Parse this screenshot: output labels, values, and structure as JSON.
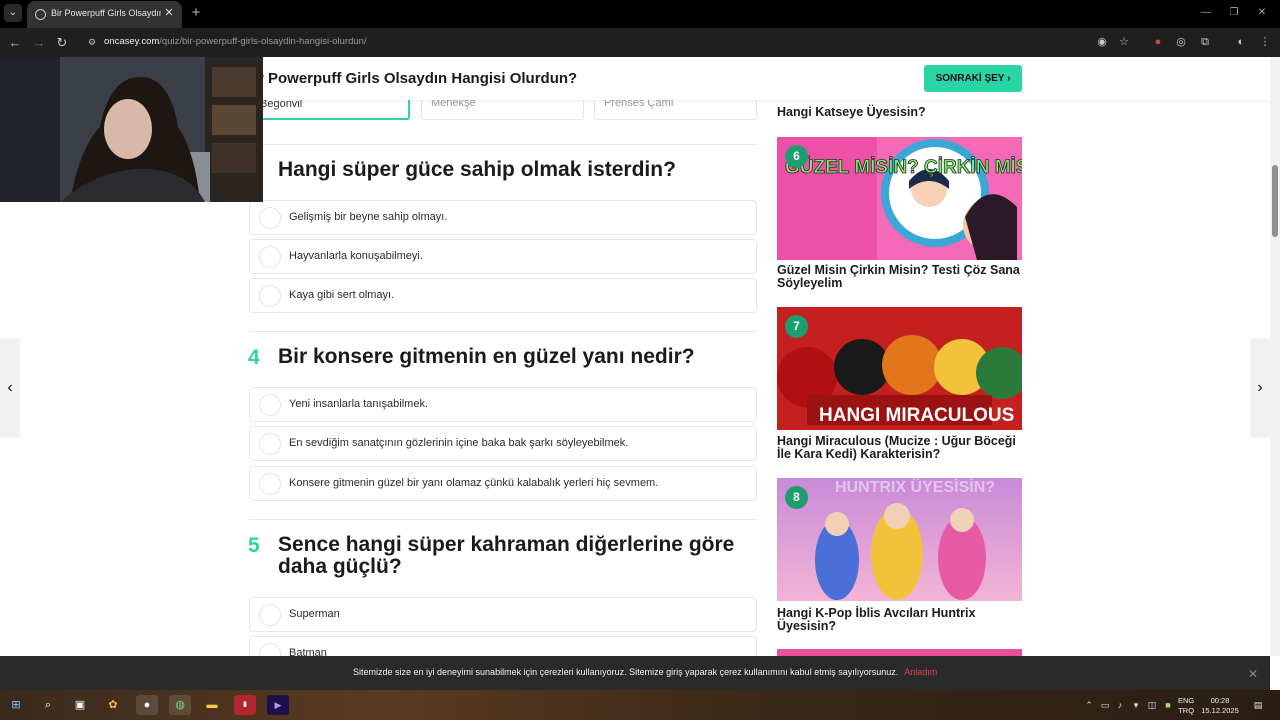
{
  "browser": {
    "tab_title": "Bir Powerpuff Girls Olsaydın Ha",
    "url_host": "oncasey.com",
    "url_path": "/quiz/bir-powerpuff-girls-olsaydin-hangisi-olurdun/"
  },
  "header": {
    "title": "r Powerpuff Girls Olsaydın Hangisi Olurdun?",
    "next_label": "SONRAKİ ŞEY"
  },
  "previous_options": [
    "Begonvil",
    "Menekşe",
    "Prenses Çamı"
  ],
  "questions": [
    {
      "number": "",
      "text": "Hangi süper güce sahip olmak isterdin?",
      "options": [
        "Gelişmiş bir beyne sahip olmayı.",
        "Hayvanlarla konuşabilmeyi.",
        "Kaya gibi sert olmayı."
      ]
    },
    {
      "number": "4",
      "text": "Bir konsere gitmenin en güzel yanı nedir?",
      "options": [
        "Yeni insanlarla tanışabilmek.",
        "En sevdiğim sanatçının gözlerinin içine baka bak şarkı söyleyebilmek.",
        "Konsere gitmenin güzel bir yanı olamaz çünkü kalabalık yerleri hiç sevmem."
      ]
    },
    {
      "number": "5",
      "text": "Sence hangi süper kahraman diğerlerine göre daha güçlü?",
      "options": [
        "Superman",
        "Batman"
      ]
    }
  ],
  "sidebar": {
    "prev_card_title": "Hangi Katseye Üyesisin?",
    "cards": [
      {
        "rank": "6",
        "title": "Güzel Misin Çirkin Misin? Testi Çöz Sana Söyleyelim",
        "image_text": "GÜZEL MİSİN? ÇİRKİN MİSİN?"
      },
      {
        "rank": "7",
        "title": "Hangi Miraculous (Mucize : Uğur Böceği İle Kara Kedi) Karakterisin?",
        "image_text": "HANGI MIRACULOUS"
      },
      {
        "rank": "8",
        "title": "Hangi K-Pop İblis Avcıları Huntrix Üyesisin?",
        "image_text": "HUNTRIX ÜYESİSİN?"
      }
    ]
  },
  "cookie": {
    "text": "Sitemizde size en iyi deneyimi sunabilmek için çerezleri kullanıyoruz. Sitemize giriş yaparak çerez kullanımını kabul etmiş sayılıyorsunuz.",
    "link": "Anladım"
  },
  "taskbar": {
    "lang_top": "ENG",
    "lang_bottom": "TRQ",
    "time": "00:28",
    "date": "15.12.2025"
  },
  "colors": {
    "accent": "#2bd4a5",
    "badge": "#1e9e6e",
    "cookie_link": "#e0424f"
  }
}
